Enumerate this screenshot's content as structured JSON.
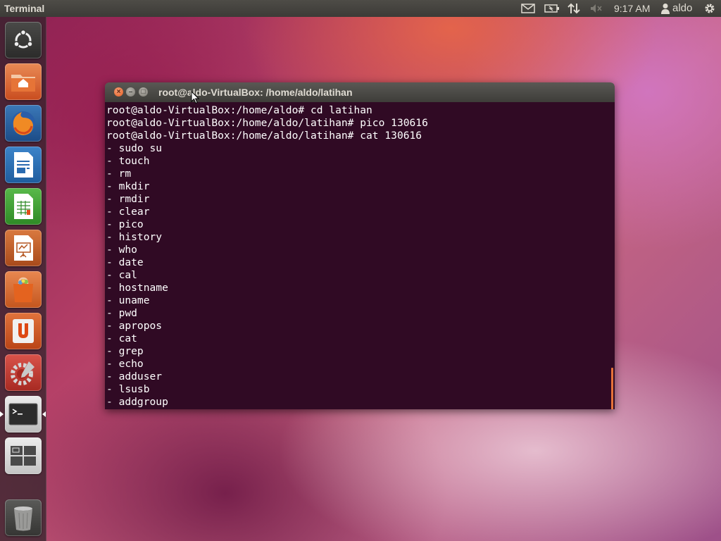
{
  "top_panel": {
    "app_title": "Terminal",
    "clock": "9:17 AM",
    "user": "aldo",
    "icons": [
      "mail-icon",
      "battery-icon",
      "network-icon",
      "volume-muted-icon",
      "user-icon",
      "gear-icon"
    ]
  },
  "launcher": {
    "items": [
      {
        "name": "dash-home",
        "icon": "ubuntu-logo-icon"
      },
      {
        "name": "home-folder",
        "icon": "home-folder-icon"
      },
      {
        "name": "firefox",
        "icon": "firefox-icon"
      },
      {
        "name": "libreoffice-writer",
        "icon": "writer-icon"
      },
      {
        "name": "libreoffice-calc",
        "icon": "calc-icon"
      },
      {
        "name": "libreoffice-impress",
        "icon": "impress-icon"
      },
      {
        "name": "software-center",
        "icon": "shopping-bag-icon"
      },
      {
        "name": "ubuntu-one",
        "icon": "ubuntu-one-icon"
      },
      {
        "name": "system-settings",
        "icon": "settings-wrench-icon"
      },
      {
        "name": "terminal",
        "icon": "terminal-icon"
      },
      {
        "name": "workspace-switcher",
        "icon": "workspaces-icon"
      },
      {
        "name": "trash",
        "icon": "trash-icon"
      }
    ]
  },
  "terminal": {
    "window_title": "root@aldo-VirtualBox: /home/aldo/latihan",
    "lines": [
      "root@aldo-VirtualBox:/home/aldo# cd latihan",
      "root@aldo-VirtualBox:/home/aldo/latihan# pico 130616",
      "root@aldo-VirtualBox:/home/aldo/latihan# cat 130616",
      "- sudo su",
      "- touch",
      "- rm",
      "- mkdir",
      "- rmdir",
      "- clear",
      "- pico",
      "- history",
      "- who",
      "- date",
      "- cal",
      "- hostname",
      "- uname",
      "- pwd",
      "- apropos",
      "- cat",
      "- grep",
      "- echo",
      "- adduser",
      "- lsusb",
      "- addgroup"
    ],
    "colors": {
      "background": "#300a24",
      "text": "#ffffff",
      "scrollbar": "#e5723a"
    }
  }
}
